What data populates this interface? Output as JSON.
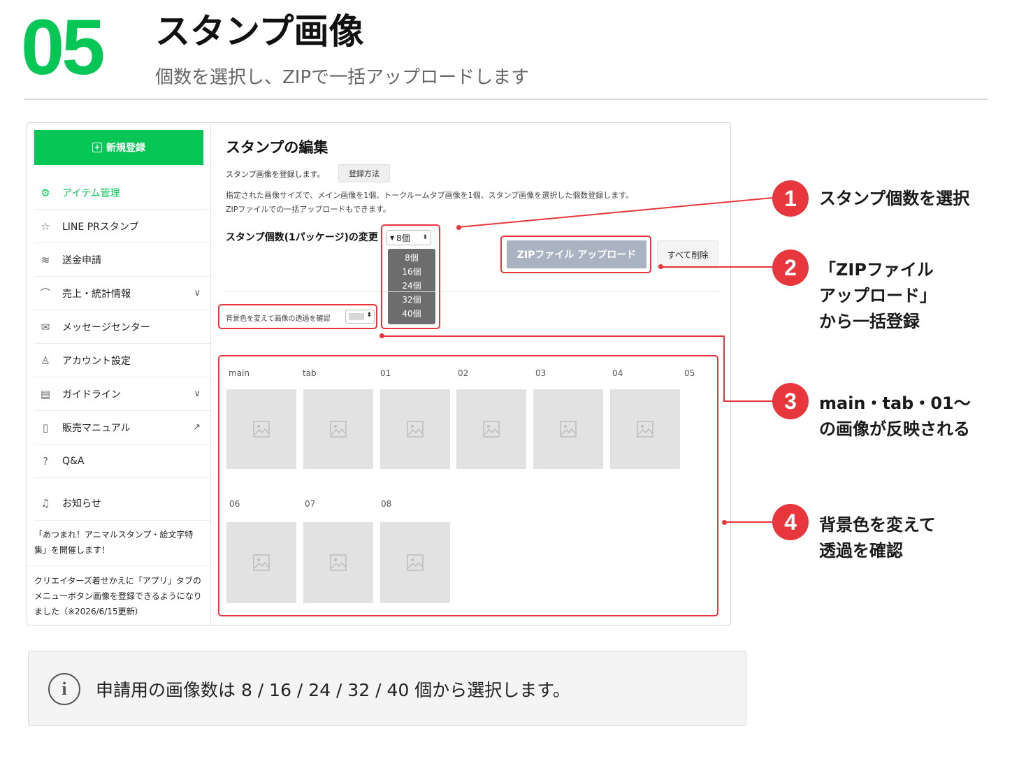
{
  "header": {
    "step_number": "05",
    "title": "スタンプ画像",
    "subtitle": "個数を選択し、ZIPで一括アップロードします"
  },
  "sidebar": {
    "new_button_label": "新規登録",
    "items": [
      {
        "label": "アイテム管理",
        "icon": "gear-icon",
        "active": true
      },
      {
        "label": "LINE PRスタンプ",
        "icon": "star-icon"
      },
      {
        "label": "送金申請",
        "icon": "coins-icon"
      },
      {
        "label": "売上・統計情報",
        "icon": "chart-icon",
        "expandable": true
      },
      {
        "label": "メッセージセンター",
        "icon": "mail-icon"
      },
      {
        "label": "アカウント設定",
        "icon": "user-icon"
      },
      {
        "label": "ガイドライン",
        "icon": "document-icon",
        "expandable": true
      },
      {
        "label": "販売マニュアル",
        "icon": "book-icon",
        "external": true
      },
      {
        "label": "Q&A",
        "icon": "question-icon"
      },
      {
        "label": "お知らせ",
        "icon": "bell-icon"
      }
    ],
    "news": [
      "「あつまれ！アニマルスタンプ・絵文字特集」を開催します！",
      "クリエイターズ着せかえに「アプリ」タブのメニューボタン画像を登録できるようになりました（※2026/6/15更新）"
    ]
  },
  "editor": {
    "title": "スタンプの編集",
    "lead": "スタンプ画像を登録します。",
    "howto_button": "登録方法",
    "description_line1": "指定された画像サイズで、メイン画像を1個、トークルームタブ画像を1個、スタンプ画像を選択した個数登録します。",
    "description_line2": "ZIPファイルでの一括アップロードもできます。",
    "count_label": "スタンプ個数(1パッケージ)の変更",
    "count_selected": "8個",
    "count_options": [
      "8個",
      "16個",
      "24個",
      "32個",
      "40個"
    ],
    "zip_button": "ZIPファイル アップロード",
    "delete_all_button": "すべて削除",
    "bg_label": "背景色を変えて画像の透過を確認",
    "slot_labels_row1": [
      "main",
      "tab",
      "01",
      "02",
      "03",
      "04",
      "05"
    ],
    "slot_labels_row2": [
      "06",
      "07",
      "08"
    ]
  },
  "callouts": [
    {
      "number": "1",
      "text": "スタンプ個数を選択"
    },
    {
      "number": "2",
      "text": "「ZIPファイル\nアップロード」\nから一括登録"
    },
    {
      "number": "3",
      "text": "main・tab・01～\nの画像が反映される"
    },
    {
      "number": "4",
      "text": "背景色を変えて\n透過を確認"
    }
  ],
  "info": {
    "icon": "info-icon",
    "text": "申請用の画像数は 8 / 16 / 24 / 32 / 40 個から選択します。"
  },
  "colors": {
    "brand_green": "#06c755",
    "annotation_red": "#e8363d",
    "zip_button_bg": "#a9b3c1"
  }
}
